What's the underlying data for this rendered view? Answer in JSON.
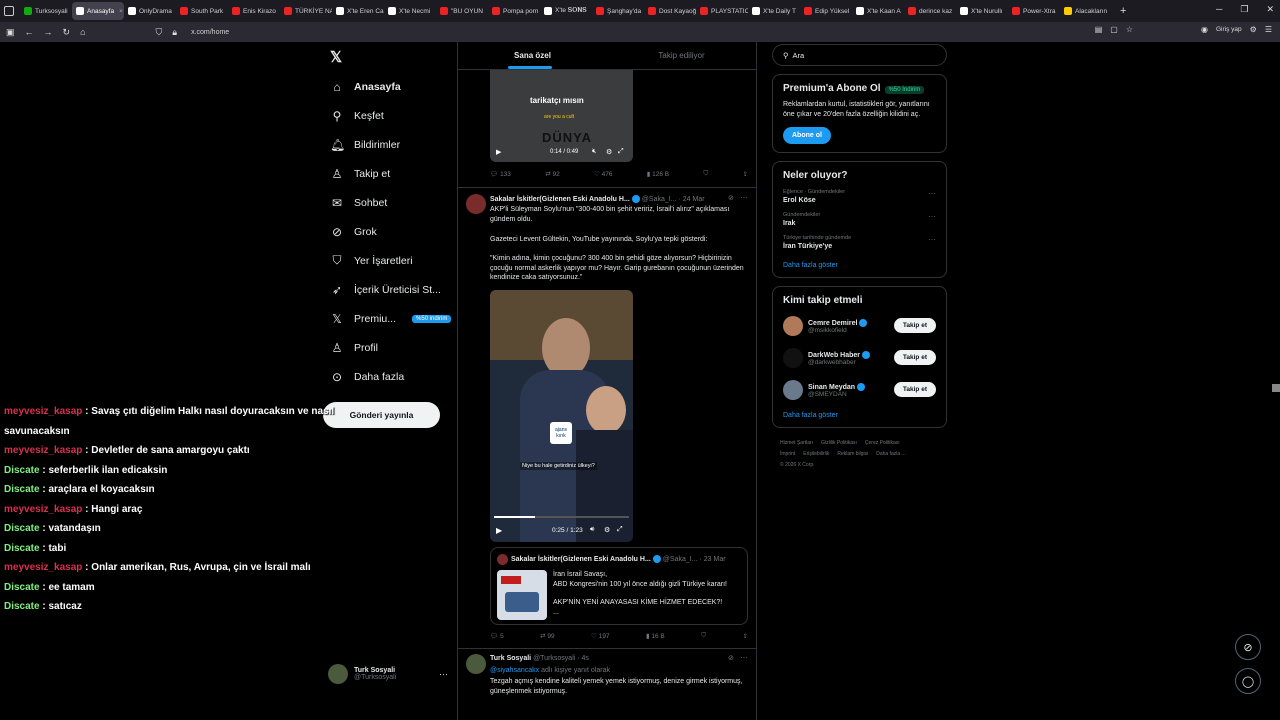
{
  "browser": {
    "tabs": [
      {
        "label": "Turksosyali",
        "color": "#1a1"
      },
      {
        "label": "Anasayfa",
        "color": "#fff",
        "active": true
      },
      {
        "label": "OnlyDrama",
        "color": "#fff"
      },
      {
        "label": "South Park",
        "color": "#e22"
      },
      {
        "label": "Enis Kirazo",
        "color": "#e22"
      },
      {
        "label": "TÜRKİYE NA",
        "color": "#e22"
      },
      {
        "label": "X'te Eren Ca",
        "color": "#fff"
      },
      {
        "label": "X'te Necmi",
        "color": "#fff"
      },
      {
        "label": "\"BU OYUN",
        "color": "#e22"
      },
      {
        "label": "Pompa porn",
        "color": "#e22"
      },
      {
        "label": "X'te 𝐒𝐎𝐍𝐒",
        "color": "#fff"
      },
      {
        "label": "Şanghay'da",
        "color": "#e22"
      },
      {
        "label": "Dost Kayaoğ",
        "color": "#e22"
      },
      {
        "label": "PLAYSTATIC",
        "color": "#e22"
      },
      {
        "label": "X'te Daily T",
        "color": "#fff"
      },
      {
        "label": "Edip Yüksel",
        "color": "#e22"
      },
      {
        "label": "X'te Kaan A",
        "color": "#fff"
      },
      {
        "label": "derince kaz",
        "color": "#e22"
      },
      {
        "label": "X'te Nurullı",
        "color": "#fff"
      },
      {
        "label": "Power-Xtra",
        "color": "#e22"
      },
      {
        "label": "Alacakların",
        "color": "#fc0"
      }
    ],
    "url": "x.com/home",
    "signin_label": "Giriş yap"
  },
  "nav": {
    "items": [
      {
        "label": "Anasayfa",
        "icon": "home-icon",
        "glyph": "⌂"
      },
      {
        "label": "Keşfet",
        "icon": "search-icon",
        "glyph": "⚲"
      },
      {
        "label": "Bildirimler",
        "icon": "bell-icon",
        "glyph": "🔔︎"
      },
      {
        "label": "Takip et",
        "icon": "add-person-icon",
        "glyph": "♙"
      },
      {
        "label": "Sohbet",
        "icon": "mail-icon",
        "glyph": "✉"
      },
      {
        "label": "Grok",
        "icon": "grok-icon",
        "glyph": "⊘"
      },
      {
        "label": "Yer İşaretleri",
        "icon": "bookmark-icon",
        "glyph": "⛉"
      },
      {
        "label": "İçerik Üreticisi St...",
        "icon": "rocket-icon",
        "glyph": "➶"
      },
      {
        "label": "Premiu...",
        "icon": "x-logo-icon",
        "glyph": "𝕏"
      },
      {
        "label": "Profil",
        "icon": "person-icon",
        "glyph": "♙"
      },
      {
        "label": "Daha fazla",
        "icon": "more-circle-icon",
        "glyph": "⊙"
      }
    ],
    "premium_badge": "%50 indirim",
    "post_button": "Gönderi yayınla",
    "profile_name": "Turk Sosyali",
    "profile_handle": "@Turksosyali"
  },
  "chat": [
    {
      "user": "meyvesiz_kasap",
      "type": "u1",
      "message": "Savaş çıtı diğelim Halkı nasıl doyuracaksın ve nasıl savunacaksın"
    },
    {
      "user": "meyvesiz_kasap",
      "type": "u1",
      "message": "Devletler de sana amargoyu çaktı"
    },
    {
      "user": "Discate",
      "type": "u2",
      "message": "seferberlik ilan edicaksin"
    },
    {
      "user": "Discate",
      "type": "u2",
      "message": "araçlara el koyacaksın"
    },
    {
      "user": "meyvesiz_kasap",
      "type": "u1",
      "message": "Hangi araç"
    },
    {
      "user": "Discate",
      "type": "u2",
      "message": "vatandaşın"
    },
    {
      "user": "Discate",
      "type": "u2",
      "message": "tabi"
    },
    {
      "user": "meyvesiz_kasap",
      "type": "u1",
      "message": "Onlar amerikan, Rus, Avrupa, çin ve İsrail malı"
    },
    {
      "user": "Discate",
      "type": "u2",
      "message": "ee tamam"
    },
    {
      "user": "Discate",
      "type": "u2",
      "message": "satıcaz"
    }
  ],
  "feed": {
    "tabs": [
      "Sana özel",
      "Takip ediliyor"
    ],
    "post1": {
      "video_text1": "tarikatçı mısın",
      "video_text2": "are you a cult",
      "video_text3": "DÜNYA",
      "time": "0:14 / 0:49",
      "replies": "133",
      "reposts": "92",
      "likes": "476",
      "views": "126 B"
    },
    "post2": {
      "name": "Sakalar İskitler(Gizlenen Eski Anadolu H...",
      "handle": "@Saka_I...",
      "date": "· 24 Mar",
      "text1": "AKP'li Süleyman Soylu'nun \"300-400 bin şehit veririz, İsrail'i alırız\" açıklaması gündem oldu.",
      "text2": "Gazeteci Levent Gültekin, YouTube yayınında, Soylu'ya tepki gösterdi:",
      "text3": "\"Kimin adına, kimin çocuğunu? 300 400 bin şehidi göze alıyorsun? Hiçbirinizin çocuğu normal askerlik yapıyor mu? Hayır. Garip gurebanın çocuğunun üzerinden kendinize caka satıyorsunuz.\"",
      "video_logo": "ajans kırık",
      "video_caption": "Niye bu hale getirdiniz ülkeyi?",
      "time": "0:25 / 1:23",
      "video_progress": 0.3,
      "quote_name": "Sakalar İskitler(Gizlenen Eski Anadolu H...",
      "quote_handle": "@Saka_I...",
      "quote_date": "· 23 Mar",
      "quote_text1": "İran İsrail Savaşı,",
      "quote_text2": "ABD Kongresi'nin 100 yıl önce aldığı gizli Türkiye kararı!",
      "quote_text3": "AKP'NİN YENİ ANAYASASI KİME HİZMET EDECEK?!",
      "quote_text4": "...",
      "replies": "5",
      "reposts": "99",
      "likes": "197",
      "views": "16 B"
    },
    "post3": {
      "name": "Turk Sosyali",
      "handle": "@Turksosyali",
      "date": "· 4s",
      "reply_to": "@siyahsancakx",
      "reply_suffix": "adlı kişiye yanıt olarak",
      "text": "Tezgah açmış kendine kaliteli yemek yemek istiyormuş, denize girmek istiyormuş, güneşlenmek istiyormuş."
    }
  },
  "right": {
    "search_placeholder": "Ara",
    "premium_title": "Premium'a Abone Ol",
    "premium_badge": "%50 İndirim",
    "premium_text": "Reklamlardan kurtul, istatistikleri gör, yanıtlarını öne çıkar ve 20'den fazla özelliğin kilidini aç.",
    "premium_button": "Abone ol",
    "trends_title": "Neler oluyor?",
    "trends": [
      {
        "category": "Eğlence · Gündemdekiler",
        "name": "Erol Köse"
      },
      {
        "category": "Gündemdekiler",
        "name": "Irak"
      },
      {
        "category": "Türkiye tarihinde gündemde",
        "name": "İran Türkiye'ye"
      }
    ],
    "show_more": "Daha fazla göster",
    "who_title": "Kimi takip etmeli",
    "who": [
      {
        "name": "Cemre Demirel",
        "handle": "@msikkofield",
        "color": "#b07a5a"
      },
      {
        "name": "DarkWeb Haber",
        "handle": "@darkwebhaber",
        "color": "#111"
      },
      {
        "name": "Sinan Meydan",
        "handle": "@SMEYDAN",
        "color": "#6a7a8c"
      }
    ],
    "follow_label": "Takip et",
    "footer_line1": [
      "Hizmet Şartları",
      "Gizlilik Politikası",
      "Çerez Politikası"
    ],
    "footer_line2": [
      "İmprint",
      "Erişilebilirlik",
      "Reklam bilgisi",
      "Daha fazla ..."
    ],
    "footer_line3": "© 2026 X Corp."
  }
}
